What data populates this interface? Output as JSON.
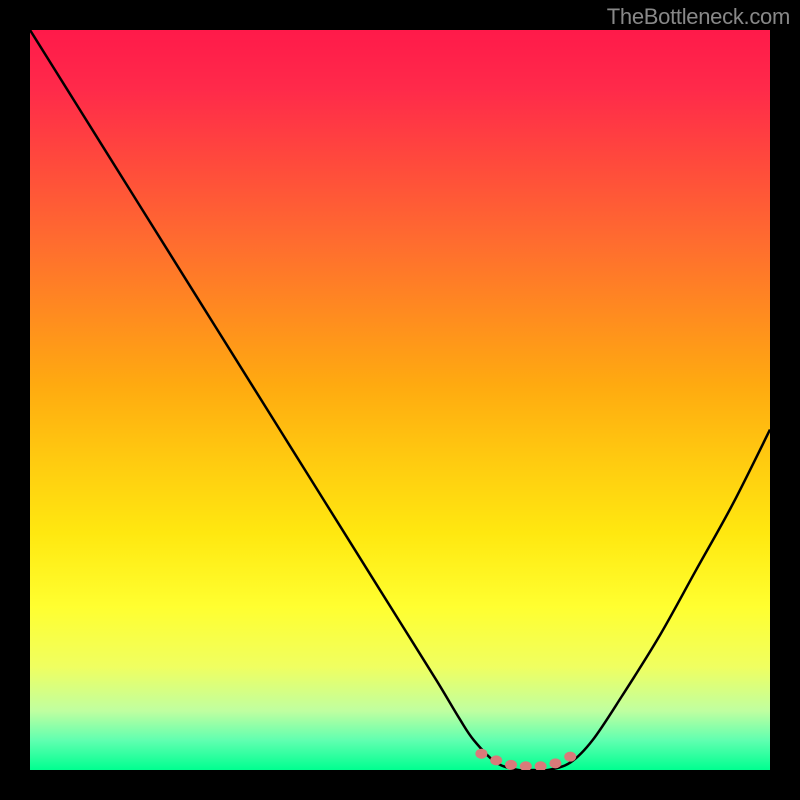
{
  "attribution": "TheBottleneck.com",
  "chart_data": {
    "type": "line",
    "title": "",
    "xlabel": "",
    "ylabel": "",
    "xlim": [
      0,
      100
    ],
    "ylim": [
      0,
      100
    ],
    "series": [
      {
        "name": "bottleneck-curve",
        "x": [
          0,
          5,
          10,
          15,
          20,
          25,
          30,
          35,
          40,
          45,
          50,
          55,
          58,
          60,
          63,
          66,
          68,
          70,
          73,
          76,
          80,
          85,
          90,
          95,
          100
        ],
        "values": [
          100,
          92,
          84,
          76,
          68,
          60,
          52,
          44,
          36,
          28,
          20,
          12,
          7,
          4,
          1,
          0,
          0,
          0,
          1,
          4,
          10,
          18,
          27,
          36,
          46
        ]
      }
    ],
    "markers": {
      "name": "optimal-range-dots",
      "x": [
        61,
        63,
        65,
        67,
        69,
        71,
        73
      ],
      "values": [
        2.2,
        1.3,
        0.7,
        0.5,
        0.5,
        0.9,
        1.8
      ],
      "color": "#d97a7a"
    },
    "gradient_colors": {
      "top": "#ff1a4a",
      "mid1": "#ff8a20",
      "mid2": "#ffe810",
      "bottom": "#00ff90"
    }
  }
}
